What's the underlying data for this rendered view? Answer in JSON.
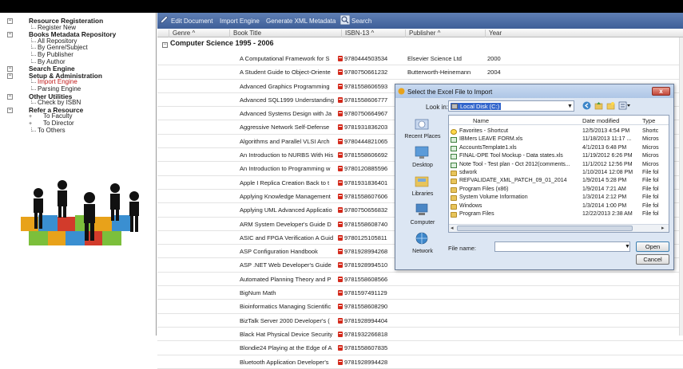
{
  "sidebar": {
    "items": [
      {
        "label": "Resource Registeration",
        "level": "cat",
        "expander": "⊟"
      },
      {
        "label": "Register New",
        "level": "sub"
      },
      {
        "label": "Books Metadata Repository",
        "level": "cat",
        "expander": "⊟"
      },
      {
        "label": "All Repository",
        "level": "sub"
      },
      {
        "label": "By Genre/Subject",
        "level": "sub"
      },
      {
        "label": "By Publisher",
        "level": "sub"
      },
      {
        "label": "By Author",
        "level": "sub"
      },
      {
        "label": "Search Engine",
        "level": "cat",
        "expander": "⊟"
      },
      {
        "label": "Setup & Administration",
        "level": "cat",
        "expander": "⊟"
      },
      {
        "label": "Import Engine",
        "level": "sub",
        "active": true
      },
      {
        "label": "Parsing Engine",
        "level": "sub"
      },
      {
        "label": "Other Utilities",
        "level": "cat",
        "expander": "⊟"
      },
      {
        "label": "Check by ISBN",
        "level": "sub"
      },
      {
        "label": "Refer a Resource",
        "level": "cat",
        "expander": "⊟"
      },
      {
        "label": "To Faculty",
        "level": "l2"
      },
      {
        "label": "To Director",
        "level": "l2"
      },
      {
        "label": "To Others",
        "level": "sub"
      }
    ]
  },
  "toolbar": {
    "edit_document": "Edit Document",
    "import_engine": "Import Engine",
    "generate_xml": "Generate XML Metadata",
    "search": "Search"
  },
  "grid": {
    "headers": {
      "genre": "Genre ^",
      "title": "Book Title",
      "isbn": "ISBN-13 ^",
      "publisher": "Publisher ^",
      "year": "Year"
    },
    "group_label": "Computer Science 1995 - 2006",
    "rows": [
      {
        "title": "A Computational Framework for S",
        "isbn": "9780444503534",
        "publisher": "Elsevier Science Ltd",
        "year": "2000"
      },
      {
        "title": "A Student Guide to Object-Oriente",
        "isbn": "9780750661232",
        "publisher": "Butterworth-Heinemann",
        "year": "2004"
      },
      {
        "title": "Advanced Graphics Programming",
        "isbn": "9781558606593",
        "publisher": "",
        "year": ""
      },
      {
        "title": "Advanced SQL1999 Understanding",
        "isbn": "9781558606777",
        "publisher": "",
        "year": ""
      },
      {
        "title": "Advanced Systems Design with Ja",
        "isbn": "9780750664967",
        "publisher": "",
        "year": ""
      },
      {
        "title": "Aggressive Network Self-Defense",
        "isbn": "9781931836203",
        "publisher": "",
        "year": ""
      },
      {
        "title": "Algorithms and Parallel VLSI Arch",
        "isbn": "9780444821065",
        "publisher": "",
        "year": ""
      },
      {
        "title": "An Introduction to NURBS With His",
        "isbn": "9781558606692",
        "publisher": "",
        "year": ""
      },
      {
        "title": "An Introduction to Programming w",
        "isbn": "9780120885596",
        "publisher": "",
        "year": ""
      },
      {
        "title": "Apple I Replica Creation Back to t",
        "isbn": "9781931836401",
        "publisher": "",
        "year": ""
      },
      {
        "title": "Applying Knowledge Management",
        "isbn": "9781558607606",
        "publisher": "",
        "year": ""
      },
      {
        "title": "Applying UML Advanced Applicatio",
        "isbn": "9780750656832",
        "publisher": "",
        "year": ""
      },
      {
        "title": "ARM System Developer's Guide D",
        "isbn": "9781558608740",
        "publisher": "",
        "year": ""
      },
      {
        "title": "ASIC and FPGA Verification A Guid",
        "isbn": "9780125105811",
        "publisher": "",
        "year": ""
      },
      {
        "title": "ASP Configuration Handbook",
        "isbn": "9781928994268",
        "publisher": "",
        "year": ""
      },
      {
        "title": "ASP .NET Web Developer's Guide",
        "isbn": "9781928994510",
        "publisher": "",
        "year": ""
      },
      {
        "title": "Automated Planning Theory and P",
        "isbn": "9781558608566",
        "publisher": "",
        "year": ""
      },
      {
        "title": "BigNum Math",
        "isbn": "9781597491129",
        "publisher": "",
        "year": ""
      },
      {
        "title": "Bioinformatics Managing Scientific",
        "isbn": "9781558608290",
        "publisher": "",
        "year": ""
      },
      {
        "title": "BizTalk Server 2000 Developer's (",
        "isbn": "9781928994404",
        "publisher": "",
        "year": ""
      },
      {
        "title": "Black Hat Physical Device Security",
        "isbn": "9781932266818",
        "publisher": "",
        "year": ""
      },
      {
        "title": "Blondie24 Playing at the Edge of A",
        "isbn": "9781558607835",
        "publisher": "",
        "year": ""
      },
      {
        "title": "Bluetooth Application Developer's",
        "isbn": "9781928994428",
        "publisher": "",
        "year": ""
      }
    ]
  },
  "dialog": {
    "title": "Select the Excel File to Import",
    "close": "x",
    "look_in_label": "Look in:",
    "look_in_value": "Local Disk (C:)",
    "places": [
      "Recent Places",
      "Desktop",
      "Libraries",
      "Computer",
      "Network"
    ],
    "columns": {
      "name": "Name",
      "date": "Date modified",
      "type": "Type"
    },
    "files": [
      {
        "name": "Favorites - Shortcut",
        "date": "12/5/2013 4:54 PM",
        "type": "Shortc",
        "icon": "star"
      },
      {
        "name": "IBMers LEAVE FORM.xls",
        "date": "11/18/2013 11:17 ...",
        "type": "Micros",
        "icon": "xls"
      },
      {
        "name": "AccountsTemplate1.xls",
        "date": "4/1/2013 6:48 PM",
        "type": "Micros",
        "icon": "xls"
      },
      {
        "name": "FINAL-DPE Tool Mockup - Data states.xls",
        "date": "11/19/2012 6:26 PM",
        "type": "Micros",
        "icon": "xls"
      },
      {
        "name": "Note Tool - Test plan - Oct 2012(comments...",
        "date": "11/1/2012 12:56 PM",
        "type": "Micros",
        "icon": "xls"
      },
      {
        "name": "sdwork",
        "date": "1/10/2014 12:08 PM",
        "type": "File fol",
        "icon": "folder"
      },
      {
        "name": "REFVALIDATE_XML_PATCH_09_01_2014",
        "date": "1/9/2014 5:28 PM",
        "type": "File fol",
        "icon": "folder"
      },
      {
        "name": "Program Files (x86)",
        "date": "1/9/2014 7:21 AM",
        "type": "File fol",
        "icon": "folder"
      },
      {
        "name": "System Volume Information",
        "date": "1/3/2014 2:12 PM",
        "type": "File fol",
        "icon": "folder"
      },
      {
        "name": "Windows",
        "date": "1/3/2014 1:00 PM",
        "type": "File fol",
        "icon": "folder"
      },
      {
        "name": "Program Files",
        "date": "12/22/2013 2:38 AM",
        "type": "File fol",
        "icon": "folder"
      }
    ],
    "file_name_label": "File name:",
    "file_name_value": "",
    "open_label": "Open",
    "cancel_label": "Cancel"
  },
  "colors": {
    "toolbar": "#4a6aa5",
    "active_item": "#c01818",
    "pdf_icon": "#d42a1c",
    "dialog_bg": "#dce6f3"
  }
}
